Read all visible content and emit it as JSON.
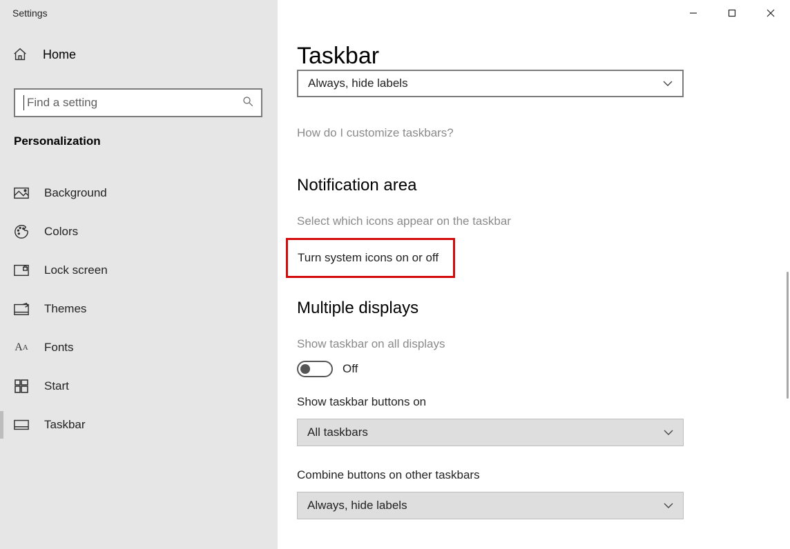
{
  "window": {
    "title": "Settings"
  },
  "sidebar": {
    "home_label": "Home",
    "search_placeholder": "Find a setting",
    "category": "Personalization",
    "items": [
      {
        "label": "Background"
      },
      {
        "label": "Colors"
      },
      {
        "label": "Lock screen"
      },
      {
        "label": "Themes"
      },
      {
        "label": "Fonts"
      },
      {
        "label": "Start"
      },
      {
        "label": "Taskbar"
      }
    ]
  },
  "main": {
    "title": "Taskbar",
    "combine_main_value": "Always, hide labels",
    "help_link": "How do I customize taskbars?",
    "section_notification": "Notification area",
    "link_select_icons": "Select which icons appear on the taskbar",
    "link_system_icons": "Turn system icons on or off",
    "section_multiple": "Multiple displays",
    "show_all_label": "Show taskbar on all displays",
    "toggle_state": "Off",
    "show_buttons_label": "Show taskbar buttons on",
    "show_buttons_value": "All taskbars",
    "combine_other_label": "Combine buttons on other taskbars",
    "combine_other_value": "Always, hide labels"
  }
}
